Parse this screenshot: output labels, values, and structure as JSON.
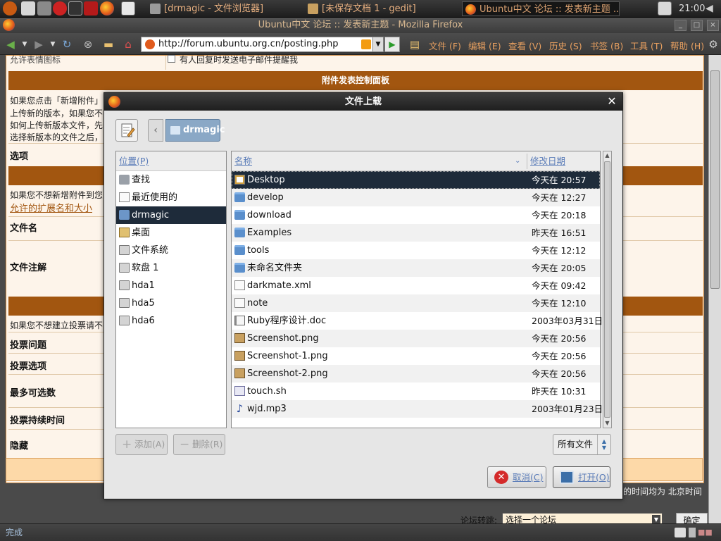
{
  "panel": {
    "tasks": [
      {
        "label": "[drmagic - 文件浏览器]"
      },
      {
        "label": "[未保存文档 1 - gedit]"
      },
      {
        "label": "Ubuntu中文 论坛 :: 发表新主题 ..."
      }
    ],
    "clock": "21:00"
  },
  "firefox": {
    "title": "Ubuntu中文 论坛 :: 发表新主题 - Mozilla Firefox",
    "url": "http://forum.ubuntu.org.cn/posting.php",
    "menus": [
      "文件 (F)",
      "编辑 (E)",
      "查看 (V)",
      "历史 (S)",
      "书签 (B)",
      "工具 (T)",
      "帮助 (H)"
    ],
    "status": "完成"
  },
  "forum": {
    "notify_option": "有人回复时发送电子邮件提醒我",
    "top_cut_text": "允许表情图标",
    "attach_panel_title": "附件发表控制面板",
    "attach_lines": [
      "如果您点击「新增附件」",
      "上传新的版本，如果您不",
      "如何上传新版本文件，先",
      "选择新版本的文件之后，"
    ],
    "options_label": "选项",
    "no_attach_line": "如果您不想新增附件到您",
    "allowed_ext_link": "允许的扩展名和大小",
    "filename_label": "文件名",
    "file_comment_label": "文件注解",
    "no_poll_line": "如果您不想建立投票请不",
    "poll_question": "投票问题",
    "poll_options": "投票选项",
    "poll_max": "最多可选数",
    "poll_duration": "投票持续时间",
    "hide_label": "隐藏",
    "timezone_text": "的时间均为 北京时间",
    "jump_label": "论坛转跳:",
    "jump_select": "选择一个论坛",
    "ok_button": "确定"
  },
  "dialog": {
    "title": "文件上载",
    "path_button": "drmagic",
    "places_header": "位置(P)",
    "places": [
      {
        "label": "查找",
        "icon": "search-icon"
      },
      {
        "label": "最近使用的",
        "icon": "document-icon"
      },
      {
        "label": "drmagic",
        "icon": "home-folder-icon",
        "selected": true
      },
      {
        "label": "桌面",
        "icon": "desktop-icon"
      },
      {
        "label": "文件系统",
        "icon": "drive-icon"
      },
      {
        "label": "软盘 1",
        "icon": "floppy-icon"
      },
      {
        "label": "hda1",
        "icon": "drive-icon"
      },
      {
        "label": "hda5",
        "icon": "drive-icon"
      },
      {
        "label": "hda6",
        "icon": "drive-icon"
      }
    ],
    "columns": {
      "name": "名称",
      "modified": "修改日期"
    },
    "files": [
      {
        "name": "Desktop",
        "date": "今天在 20:57",
        "icon": "desktop-folder-icon",
        "selected": true
      },
      {
        "name": "develop",
        "date": "今天在 12:27",
        "icon": "folder-icon"
      },
      {
        "name": "download",
        "date": "今天在 20:18",
        "icon": "folder-icon"
      },
      {
        "name": "Examples",
        "date": "昨天在 16:51",
        "icon": "folder-icon"
      },
      {
        "name": "tools",
        "date": "今天在 12:12",
        "icon": "folder-icon"
      },
      {
        "name": "未命名文件夹",
        "date": "今天在 20:05",
        "icon": "folder-icon"
      },
      {
        "name": "darkmate.xml",
        "date": "今天在 09:42",
        "icon": "file-icon"
      },
      {
        "name": "note",
        "date": "今天在 12:10",
        "icon": "file-icon"
      },
      {
        "name": "Ruby程序设计.doc",
        "date": "2003年03月31日",
        "icon": "doc-icon"
      },
      {
        "name": "Screenshot.png",
        "date": "今天在 20:56",
        "icon": "image-icon"
      },
      {
        "name": "Screenshot-1.png",
        "date": "今天在 20:56",
        "icon": "image-icon"
      },
      {
        "name": "Screenshot-2.png",
        "date": "今天在 20:56",
        "icon": "image-icon"
      },
      {
        "name": "touch.sh",
        "date": "昨天在 10:31",
        "icon": "script-icon"
      },
      {
        "name": "wjd.mp3",
        "date": "2003年01月23日",
        "icon": "audio-icon"
      }
    ],
    "add_button": "添加(A)",
    "remove_button": "删除(R)",
    "filter": "所有文件",
    "cancel_button": "取消(C)",
    "open_button": "打开(O)"
  },
  "colors": {
    "panel_bg": "#2a2a2a",
    "forum_bar": "#a25610",
    "forum_bg": "#fdf4ea",
    "selection": "#1e2b3a",
    "link": "#5a7cb8"
  }
}
